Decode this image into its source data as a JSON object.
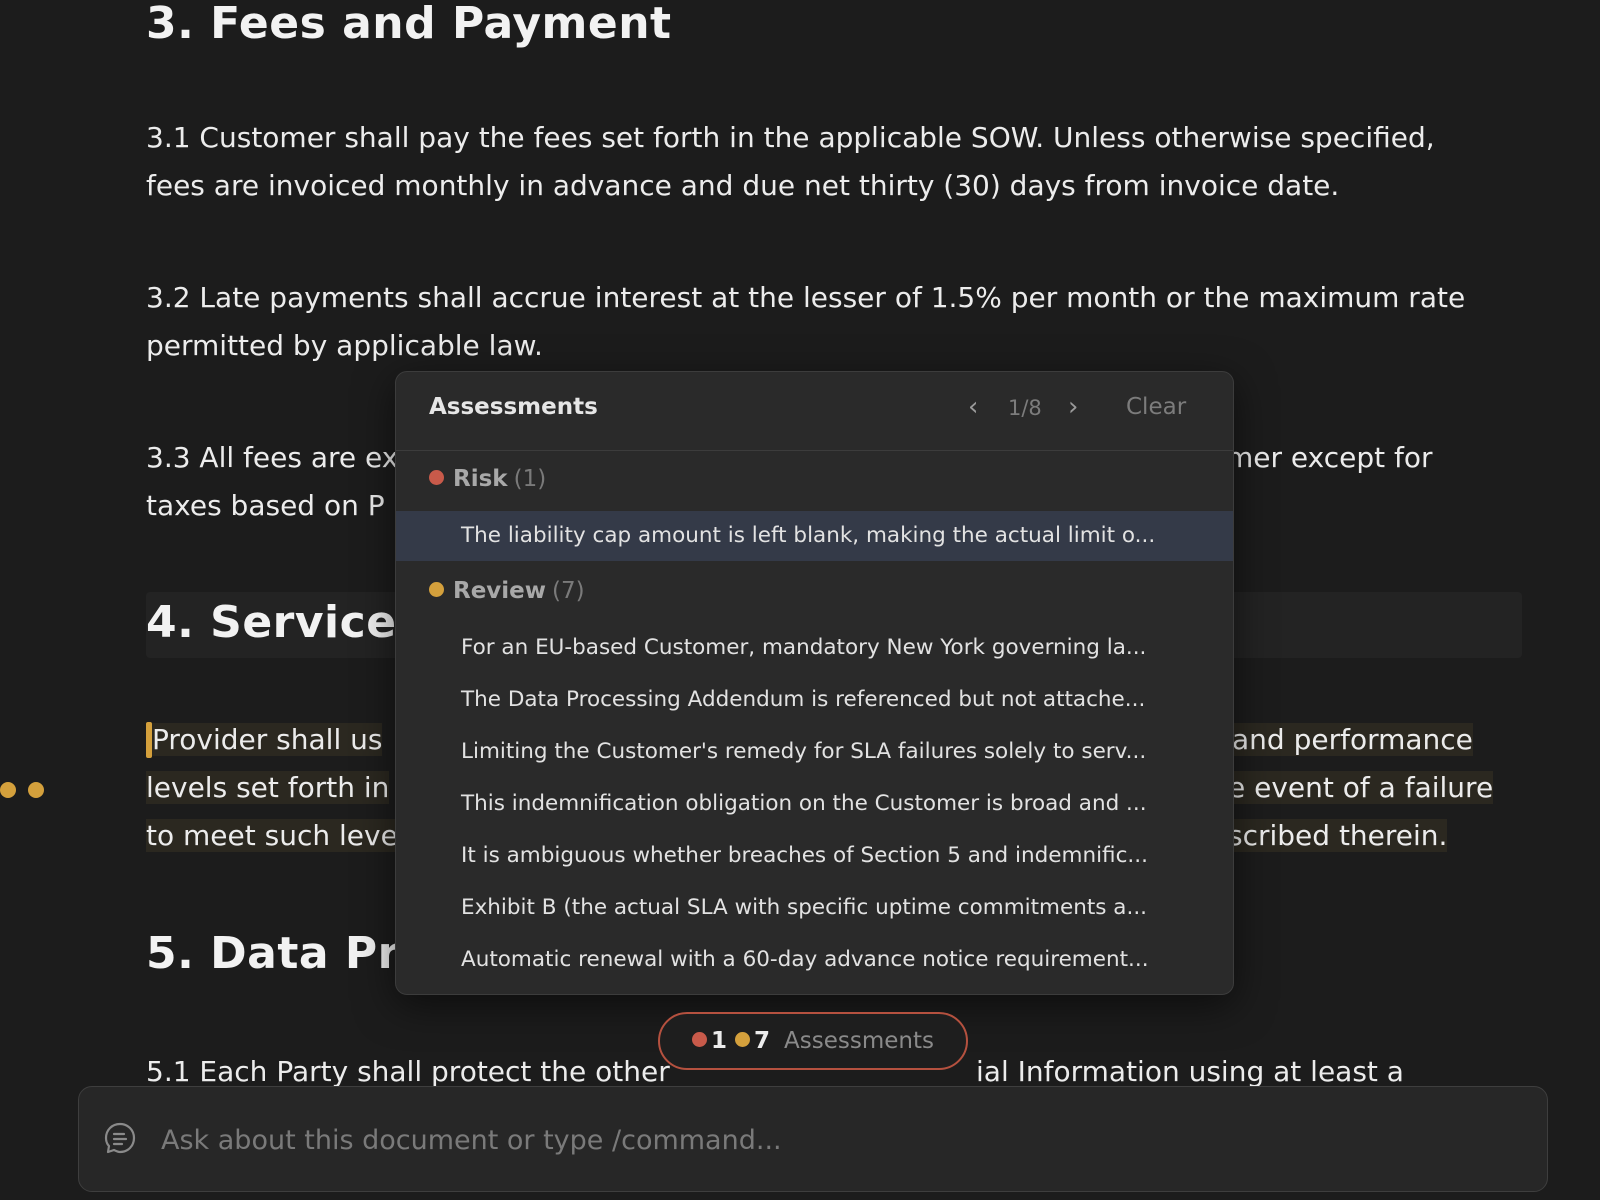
{
  "colors": {
    "risk": "#c85a4a",
    "review": "#d4a03c",
    "background": "#1c1c1c",
    "selected_row": "#343a48"
  },
  "document": {
    "section3": {
      "heading": "3. Fees and Payment",
      "p1": [
        "3.1 Customer shall pay the fees set forth in the applicable SOW. Unless otherwise specified,",
        "fees are invoiced monthly in advance and due net thirty (30) days from invoice date."
      ],
      "p2": [
        "3.2 Late payments shall accrue interest at the lesser of 1.5% per month or the maximum rate",
        "permitted by applicable law."
      ],
      "p3_visible": [
        "3.3 All fees are ex",
        "mer except for",
        "taxes based on P"
      ]
    },
    "section4": {
      "heading_visible": "4. Service L",
      "p_visible_left": [
        "Provider shall us",
        "levels set forth in",
        "to meet such leve"
      ],
      "p_visible_right": [
        "and performance",
        "e event of a failure",
        "scribed therein."
      ]
    },
    "section5": {
      "heading_visible": "5. Data Pro",
      "p1_visible_left": "5.1 Each Party shall protect the other",
      "p1_visible_right": "ial Information using at least a"
    }
  },
  "assessments_popup": {
    "title": "Assessments",
    "nav": {
      "prev": "‹",
      "next": "›",
      "position": "1/8"
    },
    "clear_label": "Clear",
    "groups": [
      {
        "name": "Risk",
        "count": "(1)",
        "items": [
          "The liability cap amount is left blank, making the actual limit o..."
        ]
      },
      {
        "name": "Review",
        "count": "(7)",
        "items": [
          "For an EU-based Customer, mandatory New York governing la...",
          "The Data Processing Addendum is referenced but not attache...",
          "Limiting the Customer's remedy for SLA failures solely to serv...",
          "This indemnification obligation on the Customer is broad and ...",
          "It is ambiguous whether breaches of Section 5 and indemnific...",
          "Exhibit B (the actual SLA with specific uptime commitments a...",
          "Automatic renewal with a 60-day advance notice requirement..."
        ]
      }
    ]
  },
  "assessments_pill": {
    "risk_count": "1",
    "review_count": "7",
    "label": "Assessments"
  },
  "chat": {
    "icon": "chat-bubble-icon",
    "placeholder": "Ask about this document or type /command..."
  }
}
